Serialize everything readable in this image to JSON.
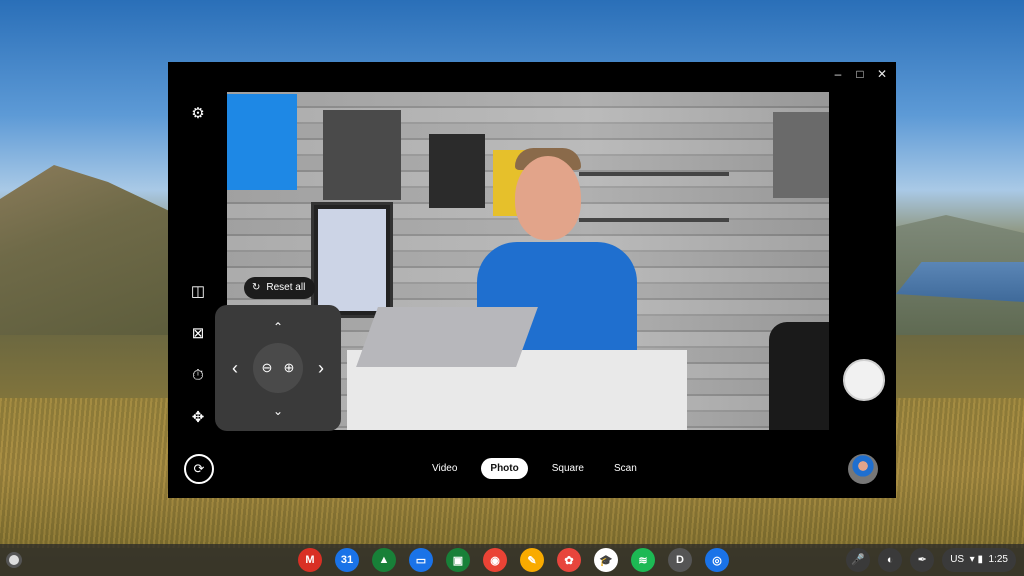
{
  "window": {
    "controls": {
      "minimize": "–",
      "maximize": "□",
      "close": "✕"
    }
  },
  "side_icons": [
    "gear-icon",
    "mirror-icon",
    "grid-off-icon",
    "timer-off-icon",
    "ptz-icon"
  ],
  "ptz": {
    "reset_label": "Reset all",
    "reset_icon": "↻",
    "up": "⌃",
    "down": "⌄",
    "left": "‹",
    "right": "›",
    "zoom_out": "⊖",
    "zoom_in": "⊕"
  },
  "modes": [
    {
      "label": "Video",
      "active": false
    },
    {
      "label": "Photo",
      "active": true
    },
    {
      "label": "Square",
      "active": false
    },
    {
      "label": "Scan",
      "active": false
    }
  ],
  "switch_camera_icon": "⟳",
  "shelf": {
    "apps": [
      {
        "name": "gmail",
        "glyph": "M",
        "color": "#d93025"
      },
      {
        "name": "calendar",
        "glyph": "31",
        "color": "#1a73e8"
      },
      {
        "name": "drive",
        "glyph": "▲",
        "color": "#188038"
      },
      {
        "name": "files",
        "glyph": "▭",
        "color": "#1a73e8"
      },
      {
        "name": "classroom",
        "glyph": "▣",
        "color": "#188038"
      },
      {
        "name": "chrome",
        "glyph": "◉",
        "color": "#ea4335"
      },
      {
        "name": "keep",
        "glyph": "✎",
        "color": "#f9ab00"
      },
      {
        "name": "canvas",
        "glyph": "✿",
        "color": "#e8453c"
      },
      {
        "name": "edu",
        "glyph": "🎓",
        "color": "#ffffff"
      },
      {
        "name": "spotify",
        "glyph": "≋",
        "color": "#1db954"
      },
      {
        "name": "d-app",
        "glyph": "D",
        "color": "#555555"
      },
      {
        "name": "camera",
        "glyph": "◎",
        "color": "#1a73e8"
      }
    ],
    "tray": {
      "mic_icon": "🎤",
      "stylus_icon": "✒",
      "assistant_icon": "◐",
      "locale": "US",
      "time": "1:25"
    }
  }
}
